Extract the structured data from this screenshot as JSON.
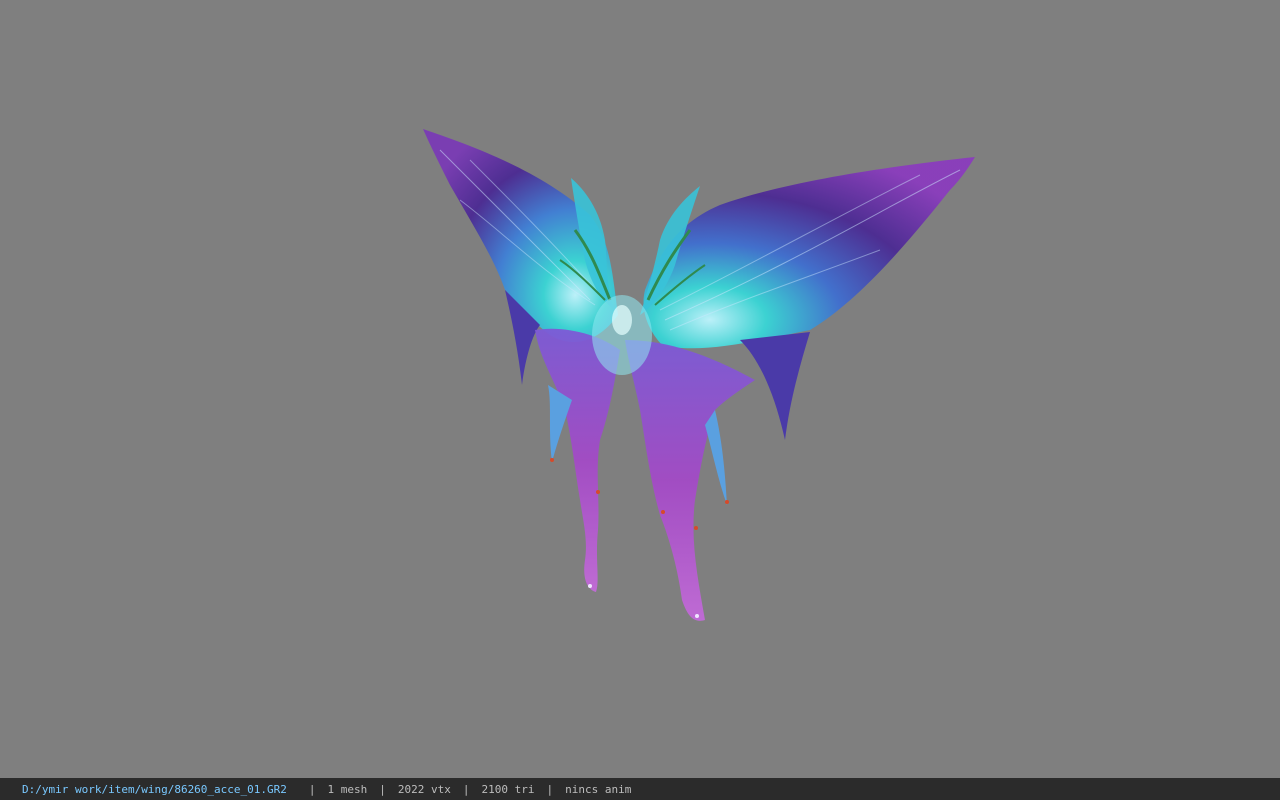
{
  "viewport": {
    "background_color": "#7f7f7f",
    "model": {
      "name": "wing-model",
      "colors": {
        "deep_purple": "#4b2a93",
        "violet": "#6a3cc2",
        "cyan": "#38d6d6",
        "magenta": "#a34ac6",
        "pink_purple": "#b06ad3",
        "accent_orange": "#d64a2a"
      }
    }
  },
  "statusbar": {
    "file_path": "D:/ymir work/item/wing/86260_acce_01.GR2",
    "separator": "|",
    "mesh_count": "1 mesh",
    "vertex_count": "2022 vtx",
    "triangle_count": "2100 tri",
    "anim_status": "nincs anim"
  }
}
